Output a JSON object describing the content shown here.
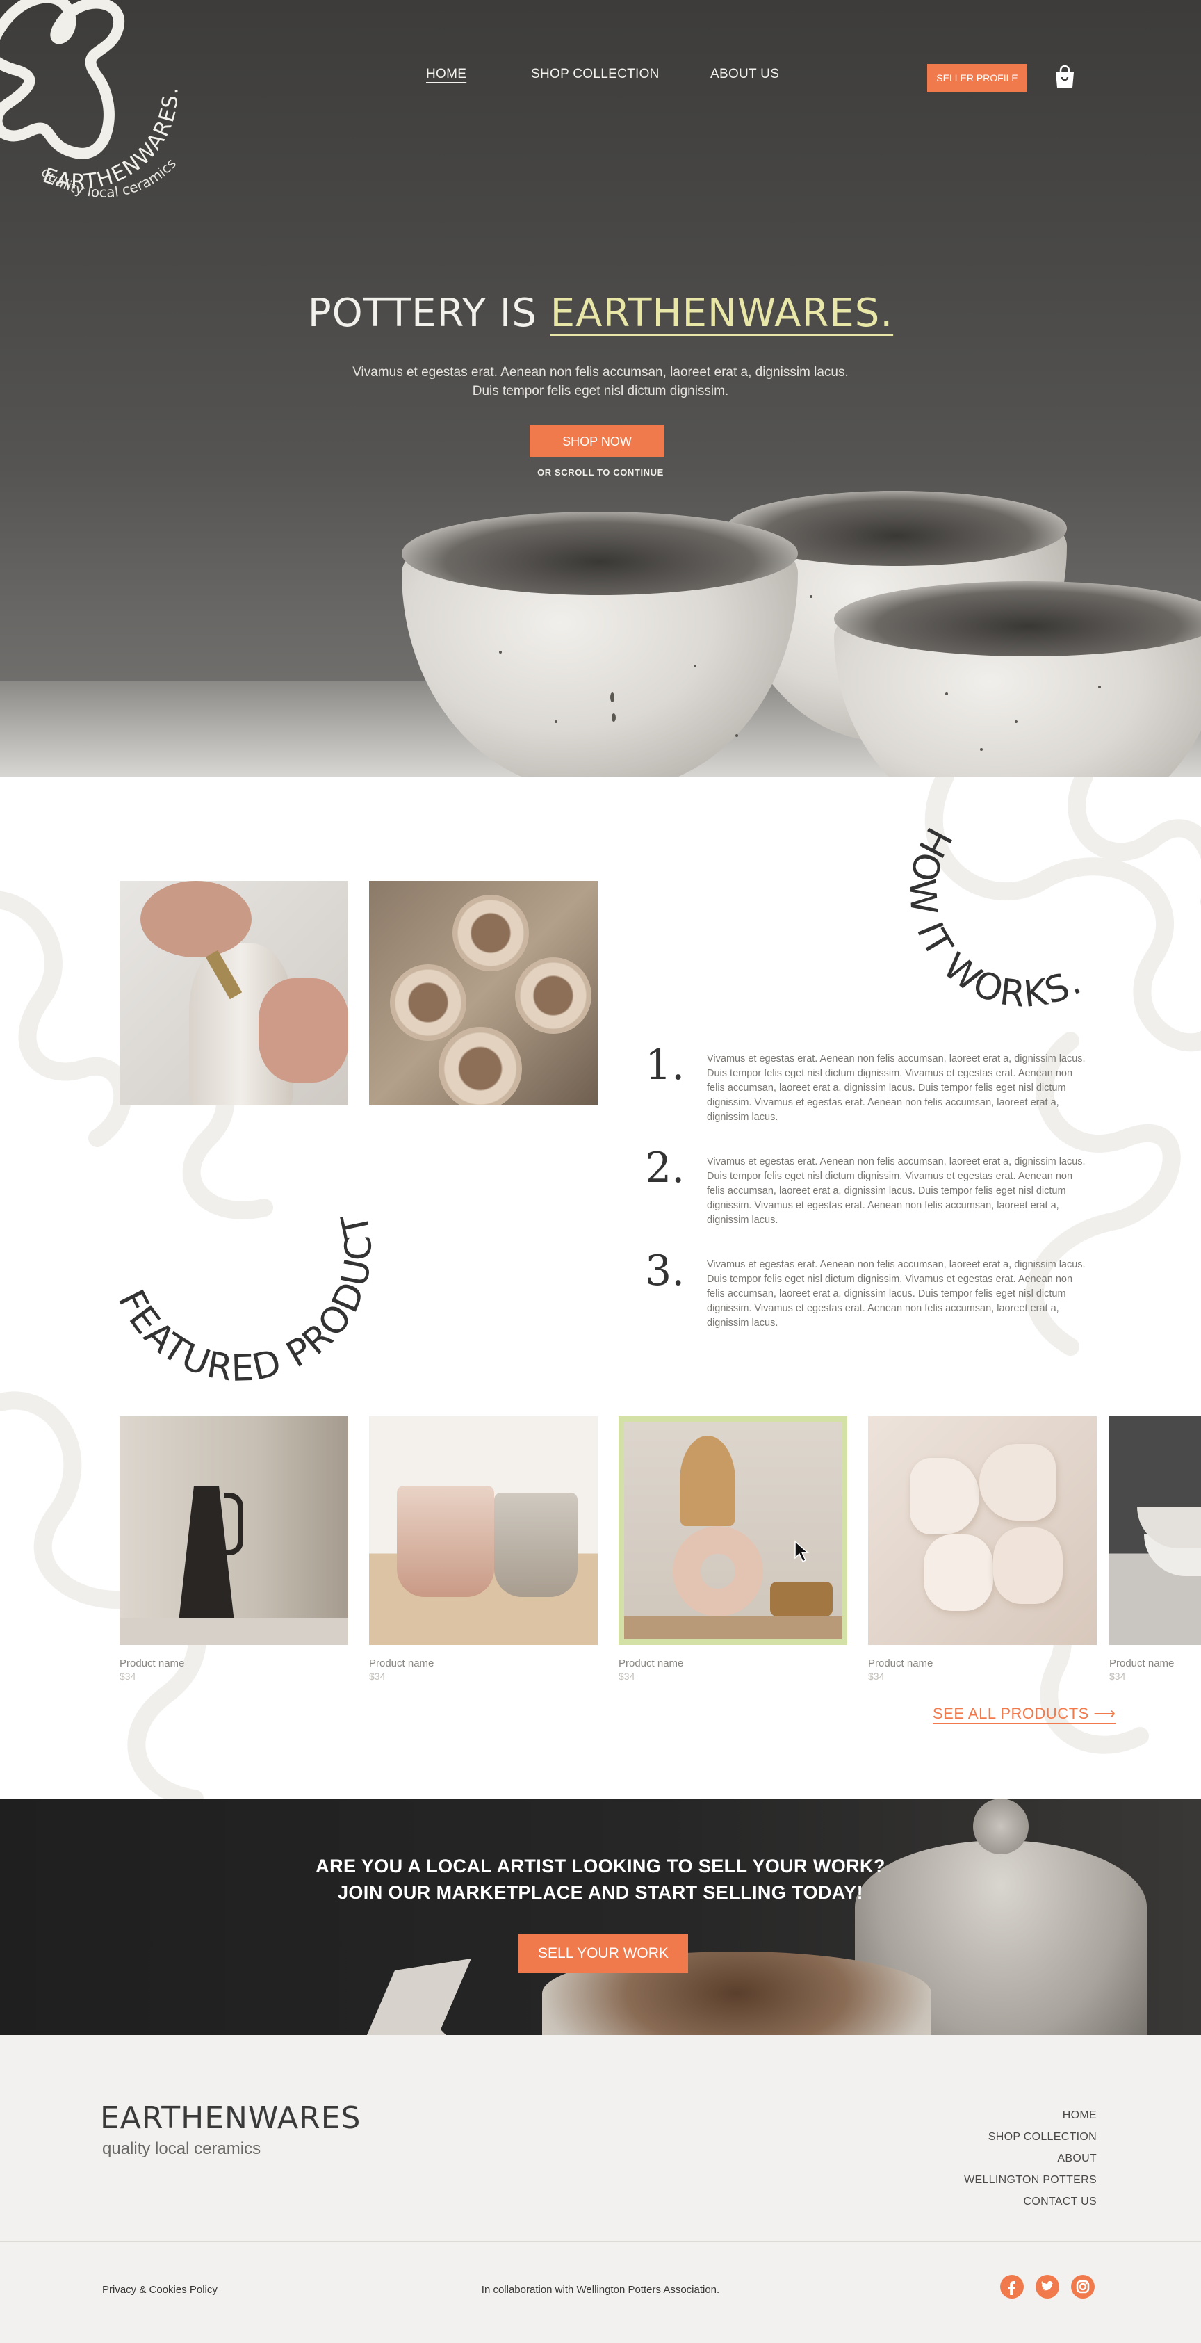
{
  "brand": {
    "name": "EARTHENWARES.",
    "tagline": "quality local ceramics"
  },
  "nav": {
    "home": "HOME",
    "shop": "SHOP COLLECTION",
    "about": "ABOUT US",
    "seller_button": "SELLER PROFILE",
    "cart_icon": "shopping-bag-icon"
  },
  "hero": {
    "title_plain": "POTTERY IS",
    "title_accent": "EARTHENWARES.",
    "subtitle_line1": "Vivamus et egestas erat. Aenean non felis accumsan, laoreet erat a, dignissim lacus.",
    "subtitle_line2": "Duis tempor felis eget nisl dictum dignissim.",
    "cta": "SHOP NOW",
    "scroll_note": "OR SCROLL TO CONTINUE"
  },
  "how_it_works": {
    "title": "HOW IT WORKS.",
    "steps": [
      {
        "number": "1.",
        "text": "Vivamus et egestas erat. Aenean non felis accumsan, laoreet erat a, dignissim lacus. Duis tempor felis eget nisl dictum dignissim. Vivamus et egestas erat. Aenean non felis accumsan, laoreet erat a, dignissim lacus. Duis tempor felis eget nisl dictum dignissim. Vivamus et egestas erat. Aenean non felis accumsan, laoreet erat a, dignissim lacus."
      },
      {
        "number": "2.",
        "text": "Vivamus et egestas erat. Aenean non felis accumsan, laoreet erat a, dignissim lacus. Duis tempor felis eget nisl dictum dignissim. Vivamus et egestas erat. Aenean non felis accumsan, laoreet erat a, dignissim lacus. Duis tempor felis eget nisl dictum dignissim. Vivamus et egestas erat. Aenean non felis accumsan, laoreet erat a, dignissim lacus."
      },
      {
        "number": "3.",
        "text": "Vivamus et egestas erat. Aenean non felis accumsan, laoreet erat a, dignissim lacus. Duis tempor felis eget nisl dictum dignissim. Vivamus et egestas erat. Aenean non felis accumsan, laoreet erat a, dignissim lacus. Duis tempor felis eget nisl dictum dignissim. Vivamus et egestas erat. Aenean non felis accumsan, laoreet erat a, dignissim lacus."
      }
    ]
  },
  "featured": {
    "title": "FEATURED PRODUCTS",
    "products": [
      {
        "name": "Product name",
        "price": "$34"
      },
      {
        "name": "Product name",
        "price": "$34"
      },
      {
        "name": "Product name",
        "price": "$34"
      },
      {
        "name": "Product name",
        "price": "$34"
      },
      {
        "name": "Product name",
        "price": "$34"
      }
    ],
    "see_all": "SEE ALL PRODUCTS  ⟶"
  },
  "cta": {
    "line1": "ARE YOU A LOCAL ARTIST LOOKING TO SELL YOUR WORK?",
    "line2": "JOIN OUR MARKETPLACE AND START SELLING TODAY!",
    "button": "SELL YOUR WORK"
  },
  "footer": {
    "brand": "EARTHENWARES",
    "tagline": "quality local ceramics",
    "links": [
      "HOME",
      "SHOP COLLECTION",
      "ABOUT",
      "WELLINGTON POTTERS",
      "CONTACT US"
    ],
    "privacy": "Privacy & Cookies Policy",
    "collab": "In collaboration with Wellington Potters Association.",
    "social": [
      "facebook-icon",
      "twitter-icon",
      "instagram-icon"
    ]
  },
  "colors": {
    "accent": "#f07a4c",
    "hero_accent_text": "#e9e7a8",
    "hover_border": "#d3e0a6"
  }
}
